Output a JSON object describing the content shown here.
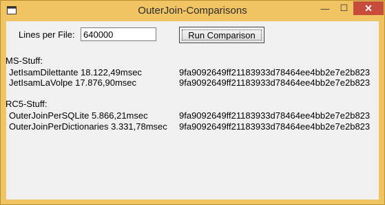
{
  "window": {
    "title": "OuterJoin-Comparisons",
    "minimize_glyph": "—",
    "maximize_glyph": "☐",
    "close_glyph": "✕",
    "icon": "app-window-icon"
  },
  "form": {
    "lines_label": "Lines per File:",
    "lines_value": "640000",
    "run_button": "Run Comparison"
  },
  "sections": [
    {
      "heading": "MS-Stuff:",
      "rows": [
        {
          "label": "JetIsamDilettante 18.122,49msec",
          "hash": "9fa9092649ff21183933d78464ee4bb2e7e2b823"
        },
        {
          "label": "JetIsamLaVolpe 17.876,90msec",
          "hash": "9fa9092649ff21183933d78464ee4bb2e7e2b823"
        }
      ]
    },
    {
      "heading": "RC5-Stuff:",
      "rows": [
        {
          "label": "OuterJoinPerSQLite 5.866,21msec",
          "hash": "9fa9092649ff21183933d78464ee4bb2e7e2b823"
        },
        {
          "label": "OuterJoinPerDictionaries 3.331,78msec",
          "hash": "9fa9092649ff21183933d78464ee4bb2e7e2b823"
        }
      ]
    }
  ]
}
